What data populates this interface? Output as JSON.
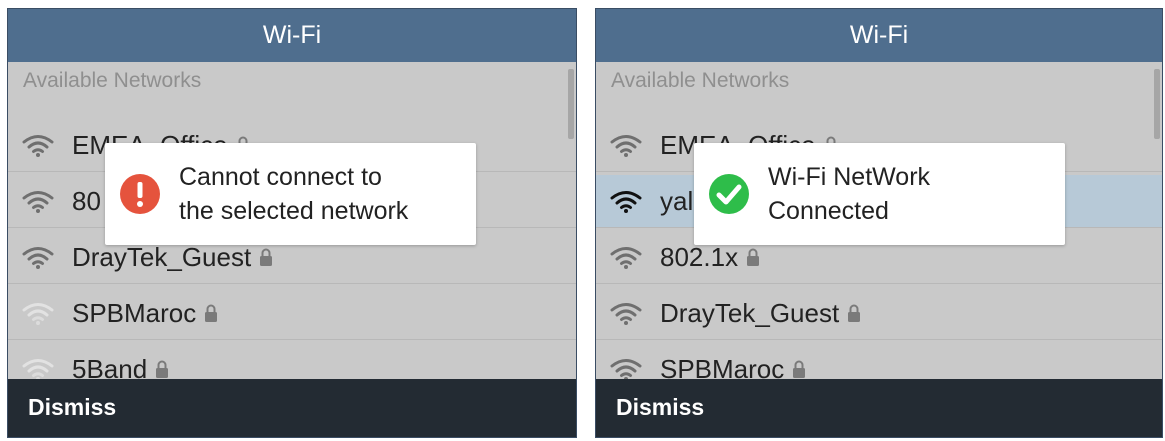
{
  "left_panel": {
    "title": "Wi-Fi",
    "section_label": "Available Networks",
    "networks": [
      {
        "ssid": "EMEA_Office",
        "locked": true,
        "signal": "medium"
      },
      {
        "ssid": "80",
        "locked": false,
        "signal": "medium"
      },
      {
        "ssid": "DrayTek_Guest",
        "locked": true,
        "signal": "medium"
      },
      {
        "ssid": "SPBMaroc",
        "locked": true,
        "signal": "weak"
      },
      {
        "ssid": "5Band",
        "locked": true,
        "signal": "weak"
      }
    ],
    "toast": {
      "line1": "Cannot connect to",
      "line2": "the selected network",
      "icon": "error-icon",
      "icon_color": "#e5533d"
    },
    "dismiss_label": "Dismiss"
  },
  "right_panel": {
    "title": "Wi-Fi",
    "section_label": "Available Networks",
    "networks": [
      {
        "ssid": "EMEA_Office",
        "locked": true,
        "signal": "medium"
      },
      {
        "ssid": "yal",
        "locked": false,
        "signal": "strong",
        "selected": true
      },
      {
        "ssid": "802.1x",
        "locked": true,
        "signal": "medium"
      },
      {
        "ssid": "DrayTek_Guest",
        "locked": true,
        "signal": "medium"
      },
      {
        "ssid": "SPBMaroc",
        "locked": true,
        "signal": "medium"
      }
    ],
    "toast": {
      "line1": "Wi-Fi NetWork",
      "line2": "Connected",
      "icon": "success-check-icon",
      "icon_color": "#2ebd4a"
    },
    "dismiss_label": "Dismiss"
  },
  "colors": {
    "titlebar": "#4f6e8e",
    "list_background": "#c9c9c9",
    "selected_row": "#b7c9d7",
    "bottombar": "#232b33"
  }
}
